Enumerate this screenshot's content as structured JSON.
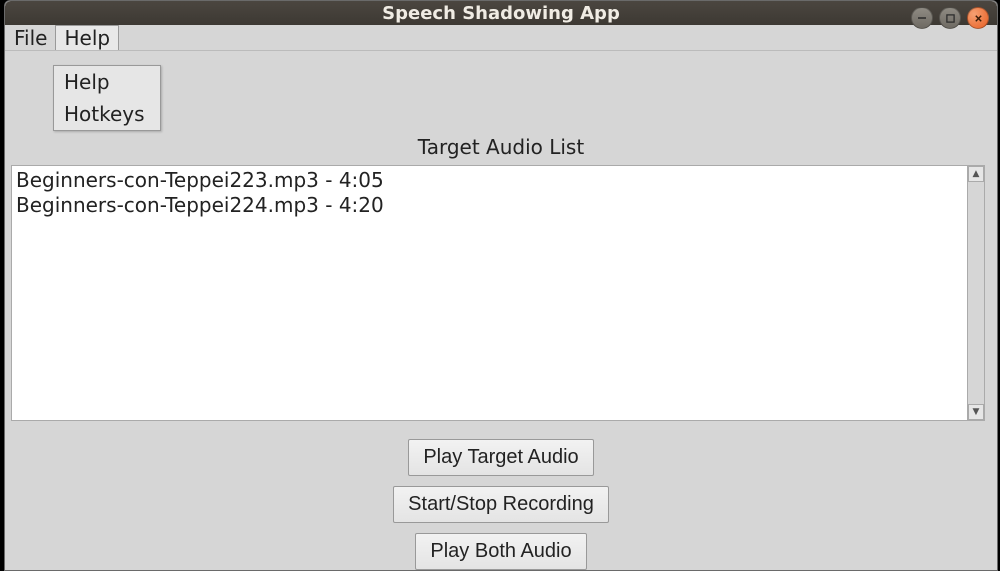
{
  "window": {
    "title": "Speech Shadowing App"
  },
  "menubar": {
    "items": [
      {
        "label": "File"
      },
      {
        "label": "Help"
      }
    ]
  },
  "dropdown": {
    "items": [
      {
        "label": "Help"
      },
      {
        "label": "Hotkeys"
      }
    ]
  },
  "list": {
    "heading": "Target Audio List",
    "items": [
      "Beginners-con-Teppei223.mp3 - 4:05",
      "Beginners-con-Teppei224.mp3 - 4:20"
    ]
  },
  "buttons": {
    "playTarget": "Play Target Audio",
    "startStopRecording": "Start/Stop Recording",
    "playBoth": "Play Both Audio"
  }
}
